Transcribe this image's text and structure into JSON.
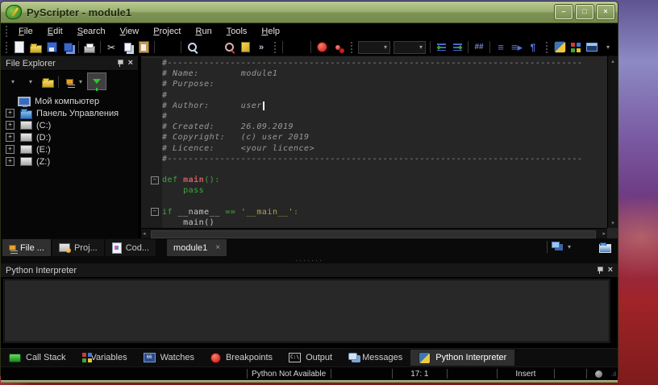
{
  "window": {
    "title": "PyScripter - module1",
    "controls": {
      "minimize": "–",
      "maximize": "□",
      "close": "×"
    }
  },
  "colors": {
    "titlebar_green": "#8ea564",
    "keyword": "#3fa83f",
    "function_name": "#d05f5f",
    "string": "#b2a34f",
    "comment": "#9a9a9a",
    "identifier": "#c8c8c8",
    "breakpoint_red": "#c42222",
    "funnel_green": "#2fc42f",
    "editor_bg": "#262626"
  },
  "menu": {
    "items": [
      "File",
      "Edit",
      "Search",
      "View",
      "Project",
      "Run",
      "Tools",
      "Help"
    ]
  },
  "toolbar": {
    "left": [
      {
        "k": "grip"
      },
      {
        "k": "icon",
        "n": "new-file-icon",
        "c": "i-new"
      },
      {
        "k": "icon",
        "n": "open-file-icon",
        "c": "i-open"
      },
      {
        "k": "icon",
        "n": "save-icon",
        "c": "i-save"
      },
      {
        "k": "icon",
        "n": "save-all-icon",
        "c": "i-saveall"
      },
      {
        "k": "sep"
      },
      {
        "k": "icon",
        "n": "print-icon",
        "c": "i-print"
      },
      {
        "k": "sep"
      },
      {
        "k": "glyph",
        "n": "cut-icon",
        "g": "✂",
        "c": "g-cut"
      },
      {
        "k": "icon",
        "n": "copy-icon",
        "c": "i-copy"
      },
      {
        "k": "icon",
        "n": "paste-icon",
        "c": "i-paste"
      },
      {
        "k": "sep"
      },
      {
        "k": "gap"
      },
      {
        "k": "sep"
      },
      {
        "k": "icon",
        "n": "search-icon",
        "c": "i-mag"
      },
      {
        "k": "gap"
      },
      {
        "k": "icon",
        "n": "search-in-files-icon",
        "c": "i-mag2"
      },
      {
        "k": "icon",
        "n": "bookmark-icon",
        "c": "i-bookmark"
      },
      {
        "k": "glyph",
        "n": "toolbar-overflow-chevron",
        "g": "»",
        "c": "tb-glyph"
      },
      {
        "k": "grip"
      },
      {
        "k": "sep"
      },
      {
        "k": "gap"
      }
    ],
    "right": [
      {
        "k": "sep"
      },
      {
        "k": "icon",
        "n": "run-breakpoint-icon",
        "c": "i-runred"
      },
      {
        "k": "icon",
        "n": "toggle-breakpoint-pin-icon",
        "c": "i-pinred"
      },
      {
        "k": "grip"
      },
      {
        "k": "combo",
        "n": "run-configuration-combobox",
        "g": "▾"
      },
      {
        "k": "combo",
        "n": "interpreter-combobox",
        "g": "▾"
      },
      {
        "k": "sep"
      },
      {
        "k": "icon",
        "n": "indent-icon",
        "c": "i-indent"
      },
      {
        "k": "icon",
        "n": "dedent-icon",
        "c": "i-dedent"
      },
      {
        "k": "sep"
      },
      {
        "k": "glyph",
        "n": "comment-code-icon",
        "g": "##",
        "c": "g-comment"
      },
      {
        "k": "sep"
      },
      {
        "k": "glyph",
        "n": "todo-list-icon",
        "g": "≡",
        "c": "g-list"
      },
      {
        "k": "glyph",
        "n": "goto-definition-icon",
        "g": "≡▸",
        "c": "g-list"
      },
      {
        "k": "glyph",
        "n": "show-whitespace-icon",
        "g": "¶",
        "c": "g-pilcrow"
      },
      {
        "k": "grip"
      },
      {
        "k": "icon",
        "n": "python-engine-icon",
        "c": "i-python"
      },
      {
        "k": "icon",
        "n": "ide-options-icon",
        "c": "i-grid"
      },
      {
        "k": "icon",
        "n": "layout-window-icon",
        "c": "i-winlay"
      },
      {
        "k": "glyph",
        "n": "layout-dropdown-chevron",
        "g": "▾",
        "c": "dd-chevron"
      }
    ]
  },
  "file_explorer": {
    "title": "File Explorer",
    "pin_icon": "pin-icon",
    "close_glyph": "×",
    "toolbar": {
      "dropdown_1": "▾",
      "dropdown_2": "▾",
      "open_icon": "open-folder-icon",
      "tree_view_icon": "folder-tree-icon",
      "tree_view_chevron": "▾",
      "filter_icon": "filter-funnel-icon"
    },
    "tree": [
      {
        "toggle": "",
        "icon": "computer-icon",
        "cls": "i-computer",
        "label": "Мой компьютер"
      },
      {
        "toggle": "+",
        "icon": "folder-icon",
        "cls": "i-bluefolder",
        "label": "Панель Управления"
      },
      {
        "toggle": "+",
        "icon": "drive-icon",
        "cls": "i-drive",
        "label": "(C:)"
      },
      {
        "toggle": "+",
        "icon": "drive-icon",
        "cls": "i-drive",
        "label": "(D:)"
      },
      {
        "toggle": "+",
        "icon": "drive-icon",
        "cls": "i-drive",
        "label": "(E:)"
      },
      {
        "toggle": "+",
        "icon": "drive-icon",
        "cls": "i-drive",
        "label": "(Z:)"
      }
    ]
  },
  "editor": {
    "tab_label": "module1",
    "tab_close": "×",
    "scroll_up": "▴",
    "scroll_down": "▾",
    "scroll_left": "◂",
    "scroll_right": "▸",
    "fold_glyph": "−",
    "code_lines": [
      {
        "tokens": [
          {
            "t": "#-------------------------------------------------------------------------------",
            "c": "cm"
          }
        ]
      },
      {
        "tokens": [
          {
            "t": "# Name:        module1",
            "c": "cm"
          }
        ]
      },
      {
        "tokens": [
          {
            "t": "# Purpose:",
            "c": "cm"
          }
        ]
      },
      {
        "tokens": [
          {
            "t": "#",
            "c": "cm"
          }
        ]
      },
      {
        "tokens": [
          {
            "t": "# Author:      user",
            "c": "cm"
          }
        ],
        "cursor": true
      },
      {
        "tokens": [
          {
            "t": "#",
            "c": "cm"
          }
        ]
      },
      {
        "tokens": [
          {
            "t": "# Created:     26.09.2019",
            "c": "cm"
          }
        ]
      },
      {
        "tokens": [
          {
            "t": "# Copyright:   (c) user 2019",
            "c": "cm"
          }
        ]
      },
      {
        "tokens": [
          {
            "t": "# Licence:     <your licence>",
            "c": "cm"
          }
        ]
      },
      {
        "tokens": [
          {
            "t": "#-------------------------------------------------------------------------------",
            "c": "cm"
          }
        ]
      },
      {
        "tokens": []
      },
      {
        "fold": true,
        "tokens": [
          {
            "t": "def ",
            "c": "kw"
          },
          {
            "t": "main",
            "c": "fn"
          },
          {
            "t": "():",
            "c": "kw"
          }
        ]
      },
      {
        "tokens": [
          {
            "t": "    ",
            "c": "id"
          },
          {
            "t": "pass",
            "c": "kw"
          }
        ]
      },
      {
        "tokens": []
      },
      {
        "fold": true,
        "tokens": [
          {
            "t": "if ",
            "c": "kw"
          },
          {
            "t": "__name__",
            "c": "id"
          },
          {
            "t": " == ",
            "c": "kw"
          },
          {
            "t": "'__main__'",
            "c": "str"
          },
          {
            "t": ":",
            "c": "kw"
          }
        ]
      },
      {
        "tokens": [
          {
            "t": "    main()",
            "c": "id"
          }
        ]
      }
    ]
  },
  "dock_tabs": [
    {
      "label": "File ...",
      "icon": "file-explorer-tab-icon",
      "cls": "i-tree",
      "active": true
    },
    {
      "label": "Proj...",
      "icon": "project-explorer-tab-icon",
      "cls": "i-proj",
      "active": false
    },
    {
      "label": "Cod...",
      "icon": "code-explorer-tab-icon",
      "cls": "i-codepage",
      "active": false
    }
  ],
  "tabstrip_right": {
    "cascade_windows_icon": "cascade-windows-icon",
    "cascade_chevron": "▾",
    "recent_files_icon": "files-folder-icon"
  },
  "interpreter_panel": {
    "title": "Python Interpreter",
    "close_glyph": "×"
  },
  "bottom_tabs": [
    {
      "label": "Call Stack",
      "icon": "call-stack-icon",
      "cls": "i-callstack",
      "active": false
    },
    {
      "label": "Variables",
      "icon": "variables-icon",
      "cls": "i-grid",
      "active": false
    },
    {
      "label": "Watches",
      "icon": "watches-icon",
      "cls": "i-watches",
      "glyph": "66",
      "active": false
    },
    {
      "label": "Breakpoints",
      "icon": "breakpoints-icon",
      "cls": "i-runred",
      "active": false
    },
    {
      "label": "Output",
      "icon": "output-icon",
      "cls": "i-output",
      "glyph": "C:\\",
      "active": false
    },
    {
      "label": "Messages",
      "icon": "messages-icon",
      "cls": "i-messages",
      "active": false
    },
    {
      "label": "Python Interpreter",
      "icon": "python-icon",
      "cls": "i-python",
      "active": true
    }
  ],
  "status_bar": {
    "python_status": "Python Not Available",
    "caret_position": "17: 1",
    "insert_mode": "Insert"
  }
}
